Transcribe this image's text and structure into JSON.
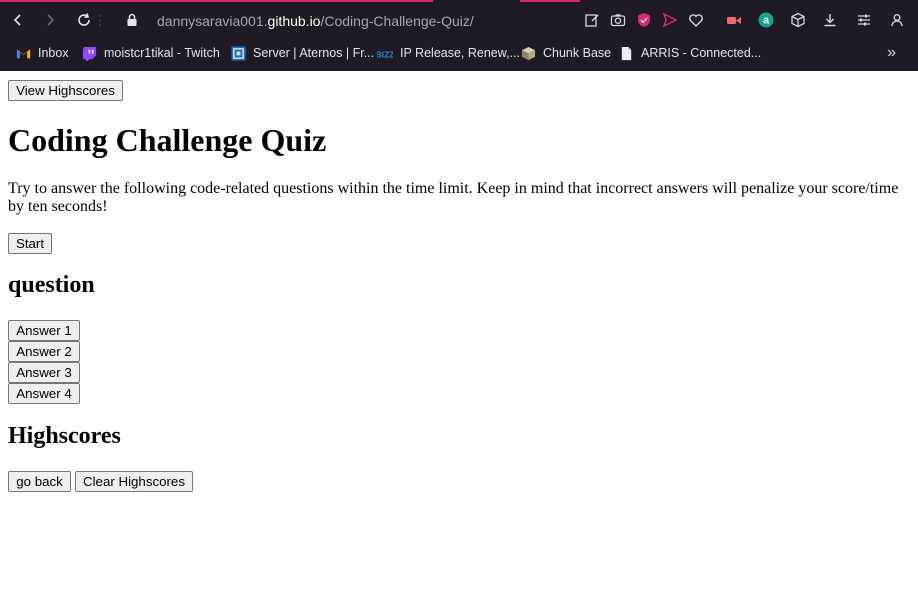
{
  "browser": {
    "url_subdomain": "dannysaravia001.",
    "url_host": "github.io",
    "url_path": "/Coding-Challenge-Quiz/",
    "accent_color": "#e2266b",
    "bookmarks": [
      {
        "label": "Inbox",
        "icon": "gmail-icon"
      },
      {
        "label": "moistcr1tikal - Twitch",
        "icon": "twitch-icon"
      },
      {
        "label": "Server | Aternos | Fr...",
        "icon": "aternos-icon"
      },
      {
        "label": "IP Release, Renew,...",
        "icon": "blizzard-icon"
      },
      {
        "label": "Chunk Base",
        "icon": "chunkbase-icon"
      },
      {
        "label": "ARRIS - Connected...",
        "icon": "document-icon"
      }
    ]
  },
  "page": {
    "view_highscores_label": "View Highscores",
    "title": "Coding Challenge Quiz",
    "intro": "Try to answer the following code-related questions within the time limit. Keep in mind that incorrect answers will penalize your score/time by ten seconds!",
    "start_label": "Start",
    "question_heading": "question",
    "answers": [
      "Answer 1",
      "Answer 2",
      "Answer 3",
      "Answer 4"
    ],
    "highscores_heading": "Highscores",
    "go_back_label": "go back",
    "clear_highscores_label": "Clear Highscores"
  }
}
